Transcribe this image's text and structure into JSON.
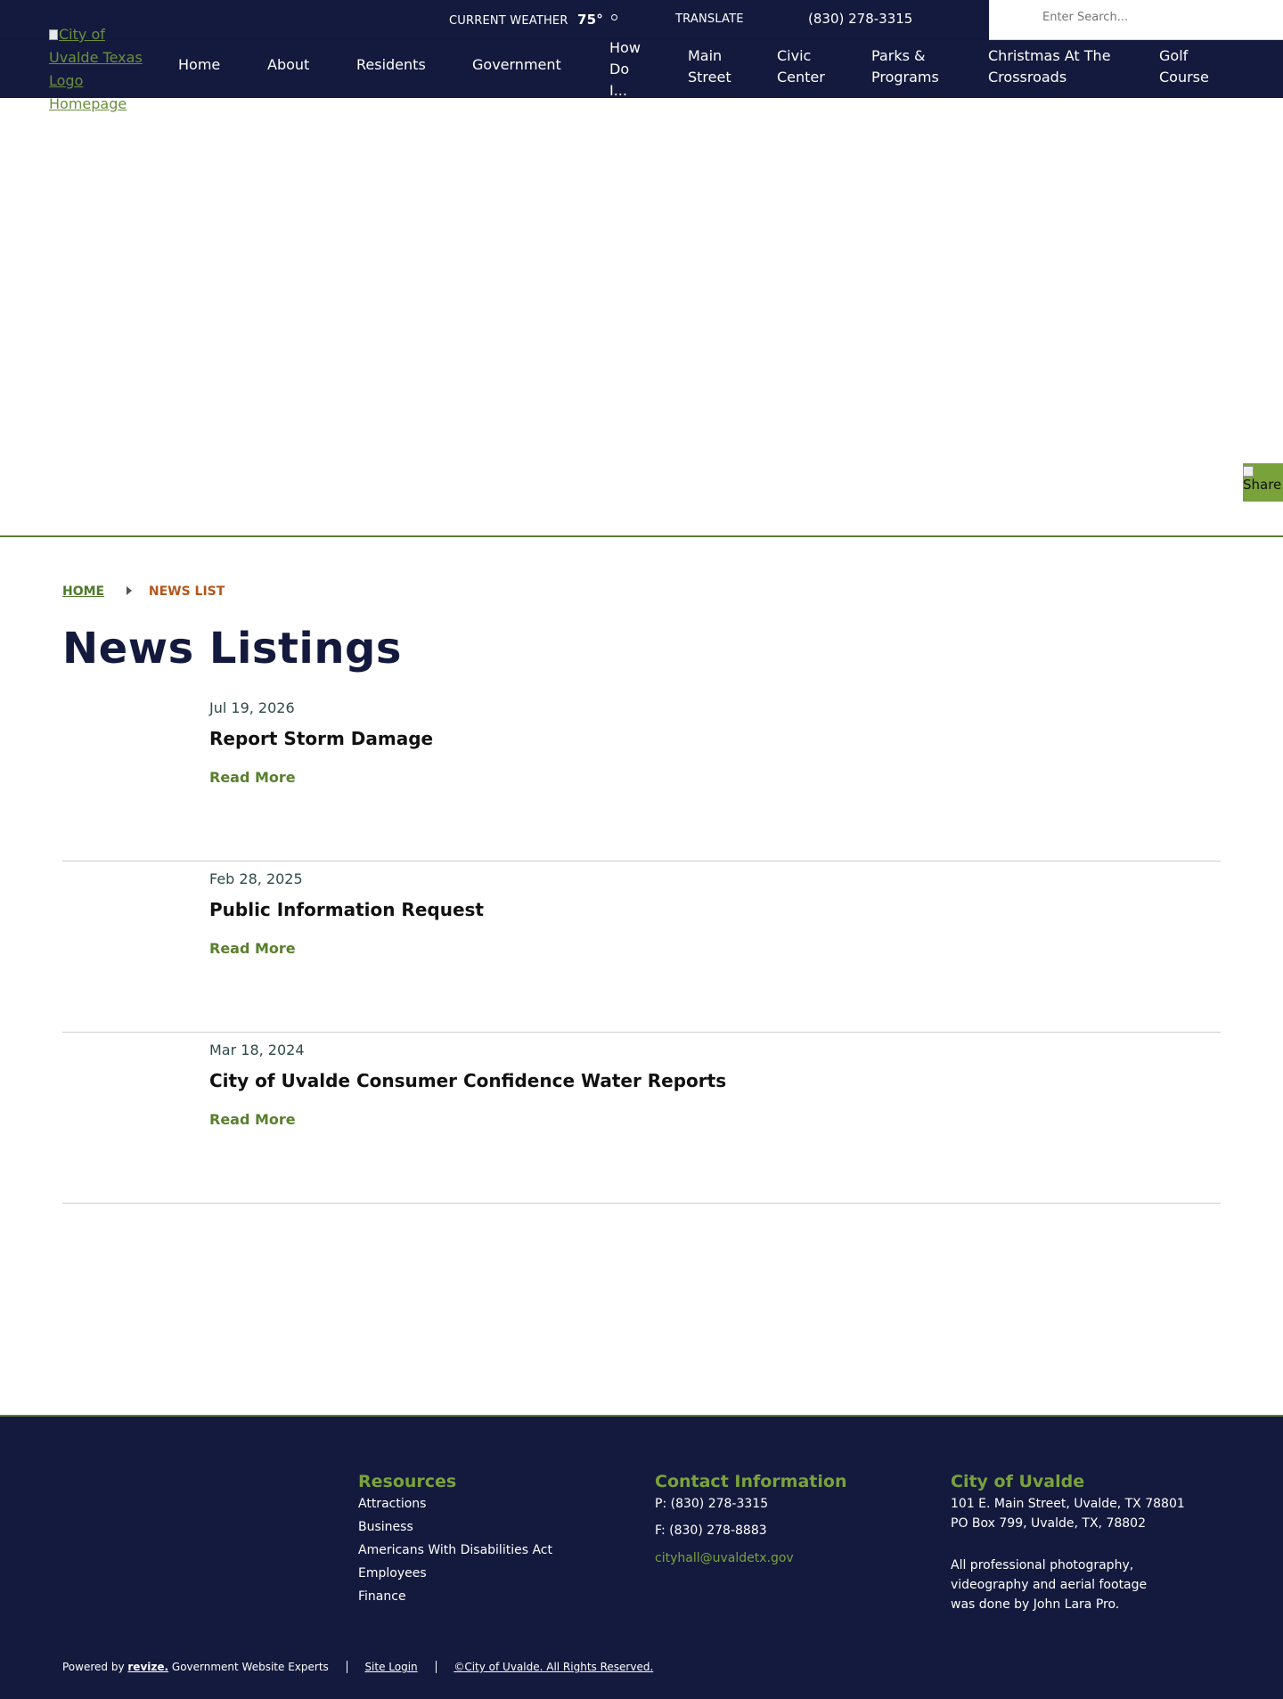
{
  "topbar": {
    "weather_label": "CURRENT WEATHER",
    "temperature": "75°",
    "translate": "TRANSLATE",
    "phone": "(830) 278-3315",
    "search_placeholder": "Enter Search..."
  },
  "logo": {
    "alt_text": "City of Uvalde Texas Logo Homepage"
  },
  "nav": {
    "items": [
      {
        "label": "Home"
      },
      {
        "label": "About"
      },
      {
        "label": "Residents"
      },
      {
        "label": "Government"
      },
      {
        "label": "How Do I..."
      },
      {
        "label": "Main Street"
      },
      {
        "label": "Civic Center"
      },
      {
        "label": "Parks & Programs"
      },
      {
        "label": "Christmas At The Crossroads"
      },
      {
        "label": "Golf Course"
      }
    ]
  },
  "share": {
    "label": "Share"
  },
  "breadcrumb": {
    "home": "HOME",
    "current": "NEWS LIST"
  },
  "page_title": "News Listings",
  "news": [
    {
      "date": "Jul 19, 2026",
      "title": "Report Storm Damage",
      "more": "Read More"
    },
    {
      "date": "Feb 28, 2025",
      "title": "Public Information Request",
      "more": "Read More"
    },
    {
      "date": "Mar 18, 2024",
      "title": "City of Uvalde Consumer Confidence Water Reports",
      "more": "Read More"
    }
  ],
  "footer": {
    "resources": {
      "heading": "Resources",
      "links": [
        "Attractions",
        "Business",
        "Americans With Disabilities Act",
        "Employees",
        "Finance"
      ]
    },
    "contact": {
      "heading": "Contact Information",
      "phone": "P: (830) 278-3315",
      "fax": "F: (830) 278-8883",
      "email": "cityhall@uvaldetx.gov"
    },
    "city": {
      "heading": "City of Uvalde",
      "address1": "101 E. Main Street, Uvalde, TX 78801",
      "address2": "PO Box 799, Uvalde, TX, 78802",
      "credit1": "All professional photography,",
      "credit2": "videography and aerial footage",
      "credit3": "was done by John Lara Pro."
    },
    "bottom": {
      "powered_prefix": "Powered by",
      "brand": "revize.",
      "powered_suffix": "Government Website Experts",
      "site_login": "Site Login",
      "copyright": "©City of Uvalde. All Rights Reserved."
    }
  },
  "colors": {
    "navy": "#141a3d",
    "green": "#7aa23b",
    "dark_green": "#5c7f33",
    "orange": "#b3571b"
  }
}
